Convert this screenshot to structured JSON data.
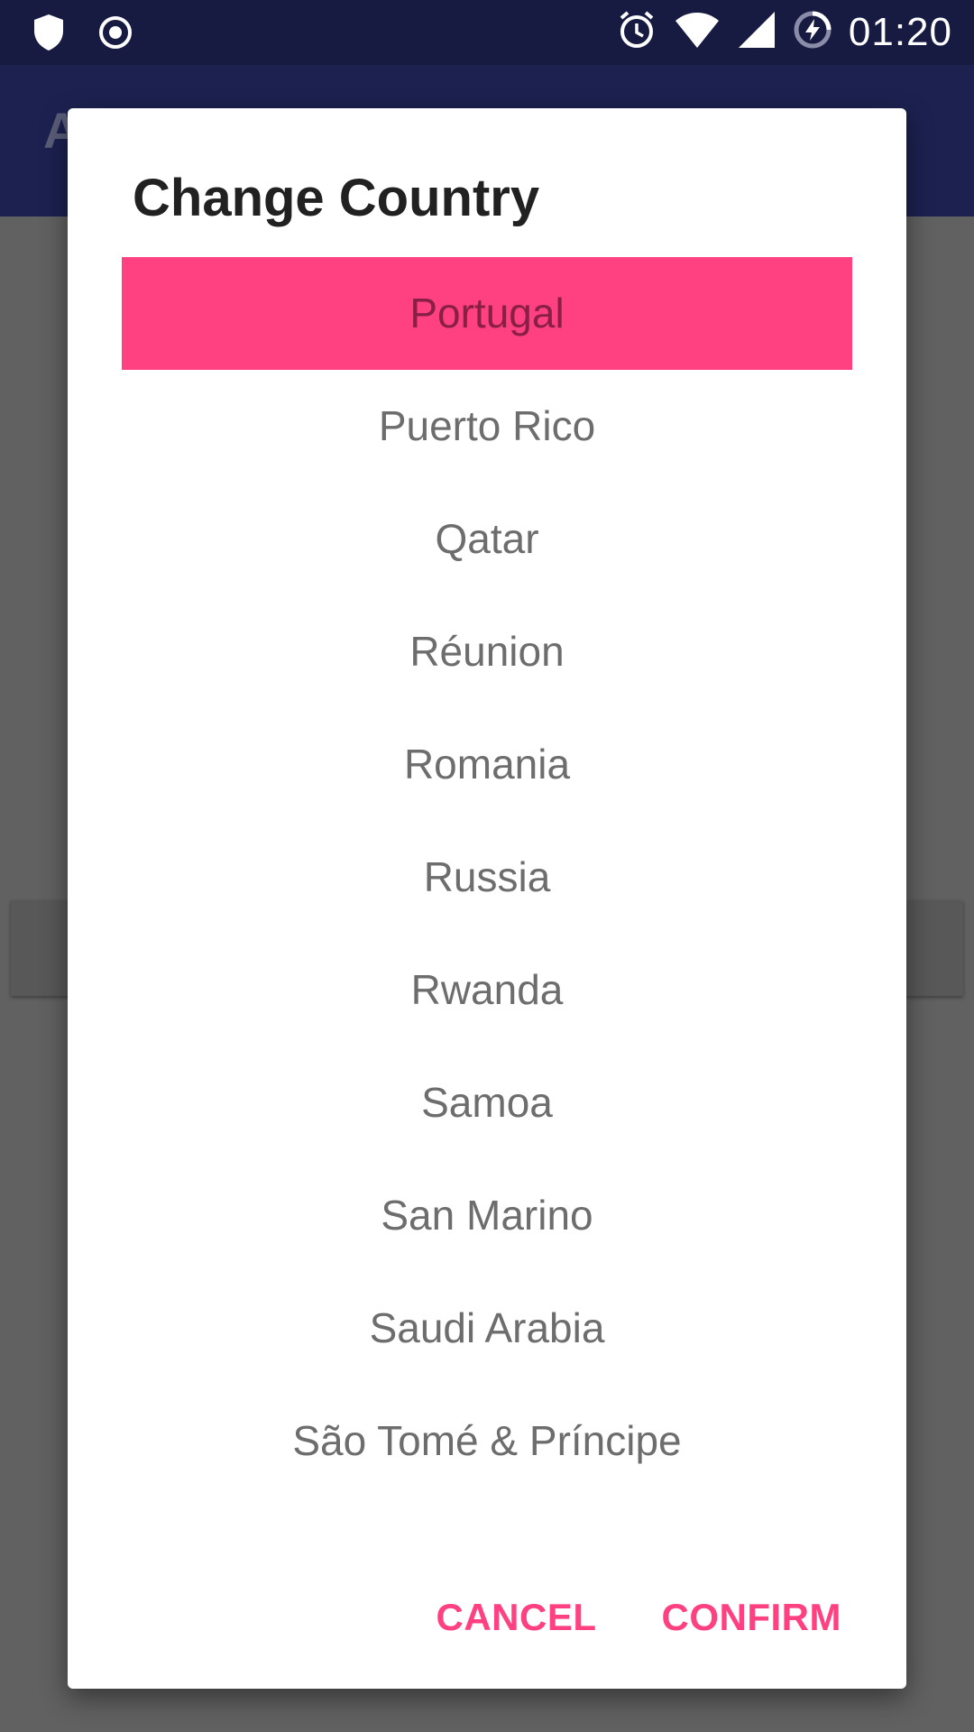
{
  "status_bar": {
    "time": "01:20",
    "icons": [
      "shield-icon",
      "record-icon",
      "alarm-icon",
      "wifi-icon",
      "signal-icon",
      "battery-charging-icon"
    ]
  },
  "app_bar": {
    "title": "A"
  },
  "dialog": {
    "title": "Change Country",
    "selected_index": 0,
    "countries": [
      "Portugal",
      "Puerto Rico",
      "Qatar",
      "Réunion",
      "Romania",
      "Russia",
      "Rwanda",
      "Samoa",
      "San Marino",
      "Saudi Arabia",
      "São Tomé & Príncipe"
    ],
    "cancel_label": "CANCEL",
    "confirm_label": "CONFIRM"
  },
  "colors": {
    "accent": "#ff4081",
    "status_bar": "#171b42",
    "app_bar": "#1c2150",
    "scrim": "#616161"
  }
}
